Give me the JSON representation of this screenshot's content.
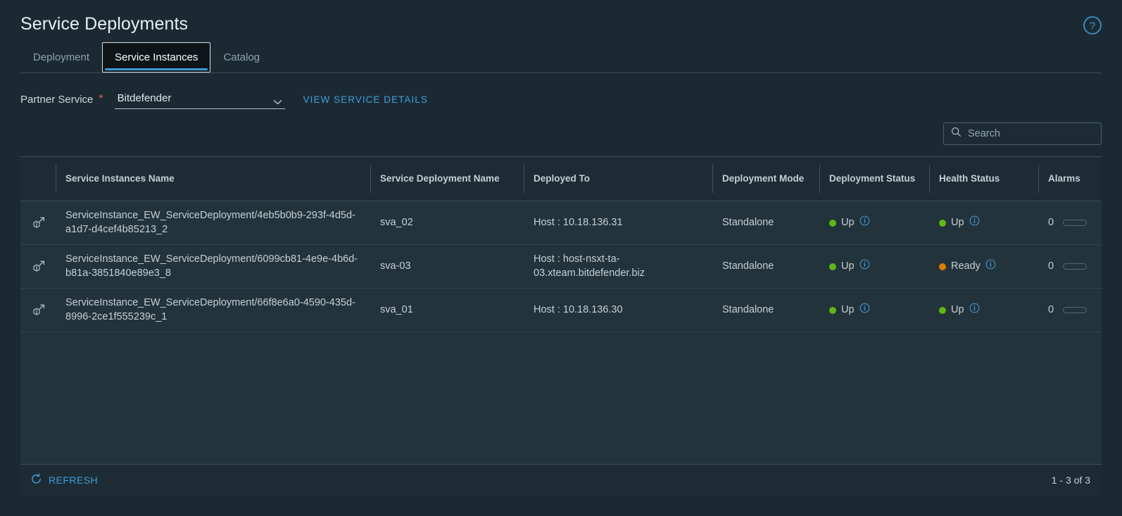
{
  "header": {
    "title": "Service Deployments",
    "help_icon": "help-circle-icon"
  },
  "tabs": [
    {
      "label": "Deployment",
      "active": false
    },
    {
      "label": "Service Instances",
      "active": true
    },
    {
      "label": "Catalog",
      "active": false
    }
  ],
  "partner_service": {
    "label": "Partner Service",
    "required_marker": "*",
    "selected_value": "Bitdefender",
    "dropdown_icon": "chevron-down-icon",
    "details_link": "VIEW SERVICE DETAILS"
  },
  "search": {
    "placeholder": "Search",
    "value": "",
    "icon": "search-icon"
  },
  "table": {
    "columns": [
      "",
      "Service Instances Name",
      "Service Deployment Name",
      "Deployed To",
      "Deployment Mode",
      "Deployment Status",
      "Health Status",
      "Alarms"
    ],
    "rows": [
      {
        "icon": "launch-cube-icon",
        "name": "ServiceInstance_EW_ServiceDeployment/4eb5b0b9-293f-4d5d-a1d7-d4cef4b85213_2",
        "deployment_name": "sva_02",
        "deployed_to": "Host : 10.18.136.31",
        "mode": "Standalone",
        "deployment_status": "Up",
        "deployment_status_color": "#5eb715",
        "health_status": "Up",
        "health_status_color": "#5eb715",
        "alarms": "0"
      },
      {
        "icon": "launch-cube-icon",
        "name": "ServiceInstance_EW_ServiceDeployment/6099cb81-4e9e-4b6d-b81a-3851840e89e3_8",
        "deployment_name": "sva-03",
        "deployed_to": "Host : host-nsxt-ta-03.xteam.bitdefender.biz",
        "mode": "Standalone",
        "deployment_status": "Up",
        "deployment_status_color": "#5eb715",
        "health_status": "Ready",
        "health_status_color": "#e07b00",
        "alarms": "0"
      },
      {
        "icon": "launch-cube-icon",
        "name": "ServiceInstance_EW_ServiceDeployment/66f8e6a0-4590-435d-8996-2ce1f555239c_1",
        "deployment_name": "sva_01",
        "deployed_to": "Host : 10.18.136.30",
        "mode": "Standalone",
        "deployment_status": "Up",
        "deployment_status_color": "#5eb715",
        "health_status": "Up",
        "health_status_color": "#5eb715",
        "alarms": "0"
      }
    ]
  },
  "footer": {
    "refresh_label": "REFRESH",
    "refresh_icon": "refresh-icon",
    "pagination": "1 - 3 of 3"
  },
  "colors": {
    "page_background": "#1b2a32",
    "table_background": "#23333b",
    "header_background": "#1d2c34",
    "accent_link": "#3f9ede",
    "status_up": "#5eb715",
    "status_ready": "#e07b00",
    "required_marker": "#e8614b"
  }
}
